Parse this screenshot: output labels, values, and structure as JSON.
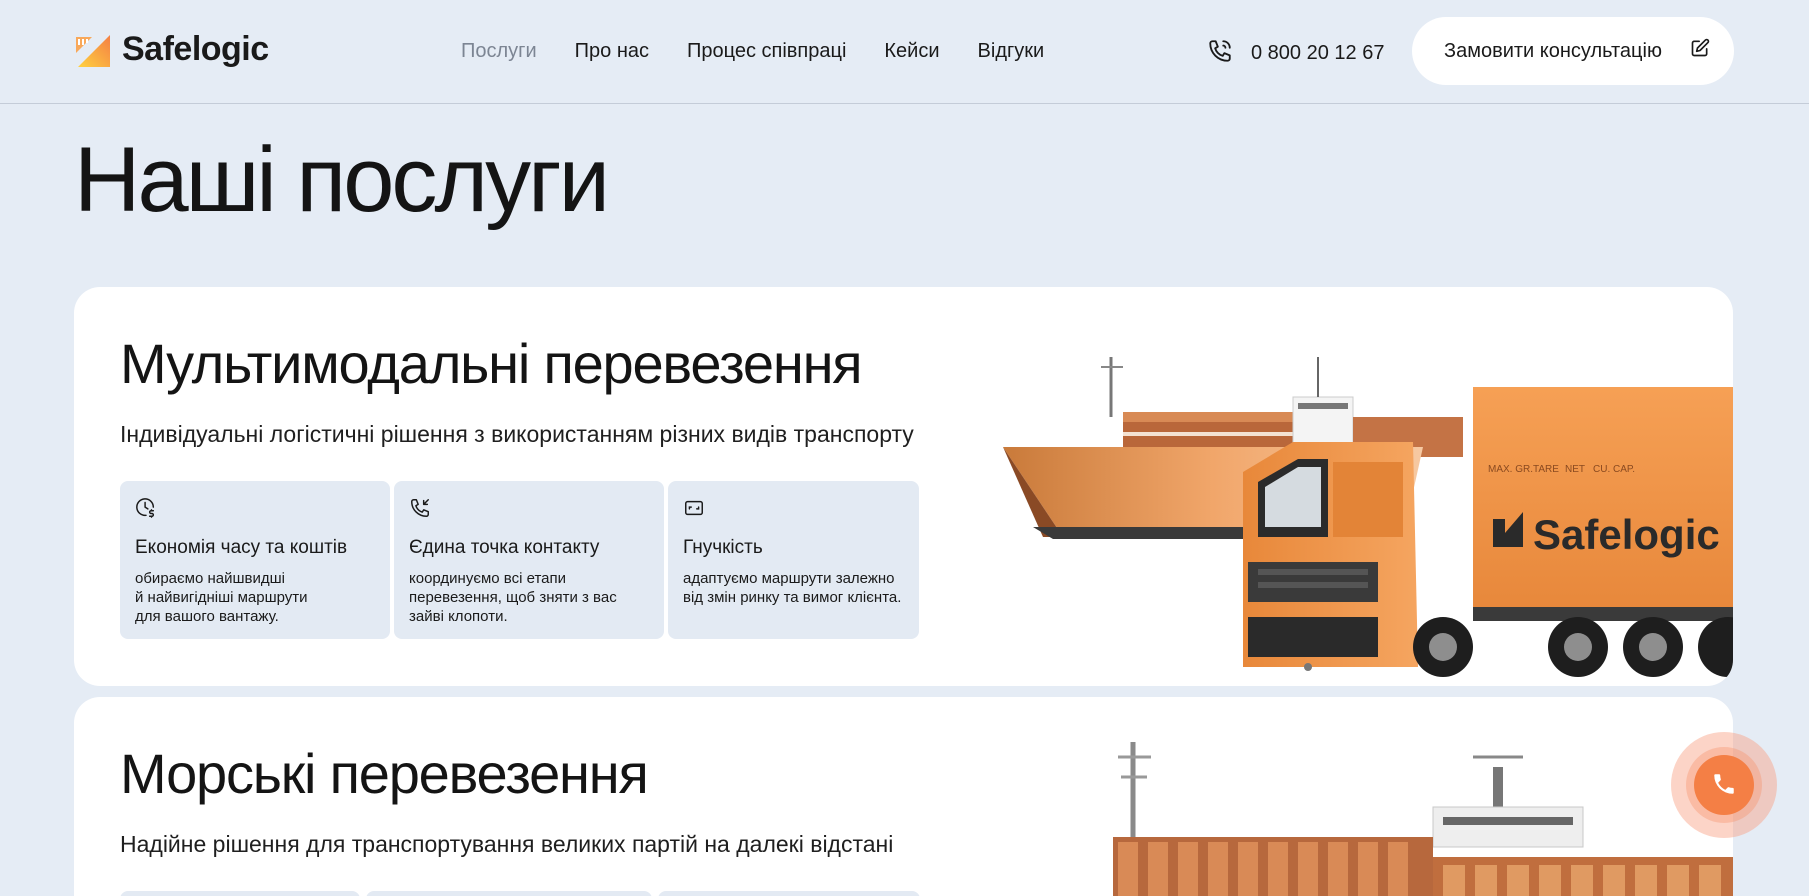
{
  "header": {
    "logo_text": "Safelogic",
    "nav": [
      {
        "label": "Послуги",
        "active": true
      },
      {
        "label": "Про нас",
        "active": false
      },
      {
        "label": "Процес співпраці",
        "active": false
      },
      {
        "label": "Кейси",
        "active": false
      },
      {
        "label": "Відгуки",
        "active": false
      }
    ],
    "phone": "0 800 20 12 67",
    "cta_label": "Замовити консультацію"
  },
  "page_title": "Наші послуги",
  "services": [
    {
      "title": "Мультимодальні перевезення",
      "subtitle": "Індивідуальні логістичні рішення з використанням різних видів транспорту",
      "features": [
        {
          "icon": "clock-dollar-icon",
          "title": "Економія часу та коштів",
          "desc": "обираємо найшвидші\nй найвигідніші маршрути\nдля вашого вантажу."
        },
        {
          "icon": "phone-incoming-icon",
          "title": "Єдина точка контакту",
          "desc": "координуємо всі етапи\nперевезення, щоб зняти з вас\nзайві клопоти."
        },
        {
          "icon": "card-icon",
          "title": "Гнучкість",
          "desc": "адаптуємо маршрути залежно\nвід змін ринку та вимог клієнта."
        }
      ],
      "illustration_brand": "Safelogic",
      "truck_marks": [
        "MAX. GR.",
        "TARE",
        "NET",
        "CU. CAP."
      ]
    },
    {
      "title": "Морські перевезення",
      "subtitle": "Надійне рішення для транспортування великих партій на далекі відстані"
    }
  ],
  "colors": {
    "accent": "#f47f45",
    "background": "#e5ecf5",
    "feature_bg": "#e3eaf3",
    "nav_active": "#7c8593"
  }
}
